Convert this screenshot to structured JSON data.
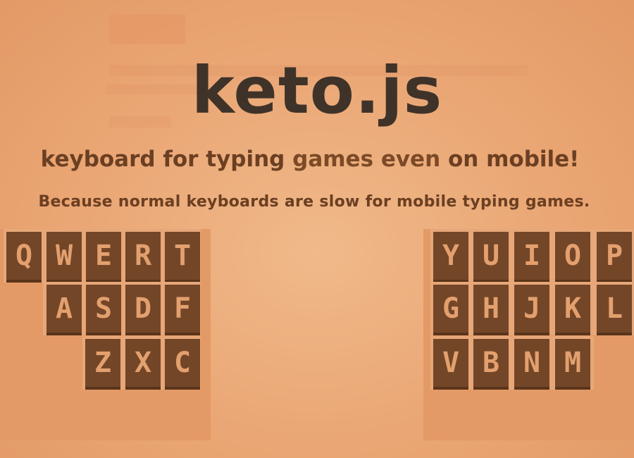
{
  "header": {
    "title": "keto.js",
    "subtitle_part1": "keyboard for typing",
    "subtitle_part2": "games even",
    "subtitle_part3": "on mobile!",
    "tagline": "Because normal keyboards are slow for mobile typing games."
  },
  "keyboard": {
    "left": {
      "row1": [
        "Q",
        "W",
        "E",
        "R",
        "T"
      ],
      "row2": [
        "A",
        "S",
        "D",
        "F"
      ],
      "row3": [
        "Z",
        "X",
        "C"
      ]
    },
    "right": {
      "row1": [
        "Y",
        "U",
        "I",
        "O",
        "P"
      ],
      "row2": [
        "G",
        "H",
        "J",
        "K",
        "L"
      ],
      "row3": [
        "V",
        "B",
        "N",
        "M"
      ]
    }
  },
  "colors": {
    "background": "#eaa674",
    "key_face": "#744628",
    "key_letter": "#e3a06e",
    "title": "#3f3329"
  }
}
